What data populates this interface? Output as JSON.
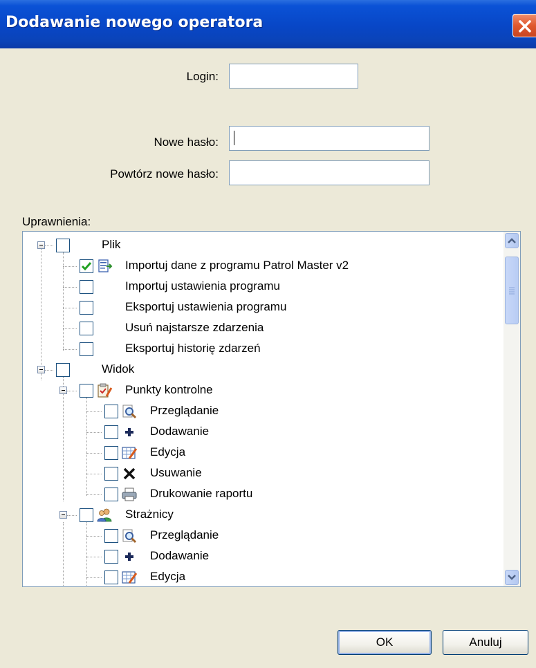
{
  "window": {
    "title": "Dodawanie nowego operatora"
  },
  "form": {
    "login_label": "Login:",
    "login_value": "",
    "new_password_label": "Nowe hasło:",
    "new_password_value": "",
    "repeat_password_label": "Powtórz nowe hasło:",
    "repeat_password_value": ""
  },
  "permissions": {
    "label": "Uprawnienia:",
    "tree": [
      {
        "label": "Plik",
        "checked": false,
        "icon": null
      },
      {
        "label": "Importuj dane z programu Patrol Master v2",
        "checked": true,
        "icon": "import-data-icon"
      },
      {
        "label": "Importuj ustawienia programu",
        "checked": false,
        "icon": null
      },
      {
        "label": "Eksportuj ustawienia programu",
        "checked": false,
        "icon": null
      },
      {
        "label": "Usuń najstarsze zdarzenia",
        "checked": false,
        "icon": null
      },
      {
        "label": "Eksportuj historię zdarzeń",
        "checked": false,
        "icon": null
      },
      {
        "label": "Widok",
        "checked": false,
        "icon": null
      },
      {
        "label": "Punkty kontrolne",
        "checked": false,
        "icon": "checklist-icon"
      },
      {
        "label": "Przeglądanie",
        "checked": false,
        "icon": "magnifier-icon"
      },
      {
        "label": "Dodawanie",
        "checked": false,
        "icon": "plus-icon"
      },
      {
        "label": "Edycja",
        "checked": false,
        "icon": "edit-grid-icon"
      },
      {
        "label": "Usuwanie",
        "checked": false,
        "icon": "delete-x-icon"
      },
      {
        "label": "Drukowanie raportu",
        "checked": false,
        "icon": "printer-icon"
      },
      {
        "label": "Strażnicy",
        "checked": false,
        "icon": "users-icon"
      },
      {
        "label": "Przeglądanie",
        "checked": false,
        "icon": "magnifier-icon"
      },
      {
        "label": "Dodawanie",
        "checked": false,
        "icon": "plus-icon"
      },
      {
        "label": "Edycja",
        "checked": false,
        "icon": "edit-grid-icon"
      }
    ]
  },
  "buttons": {
    "ok": "OK",
    "cancel": "Anuluj"
  }
}
